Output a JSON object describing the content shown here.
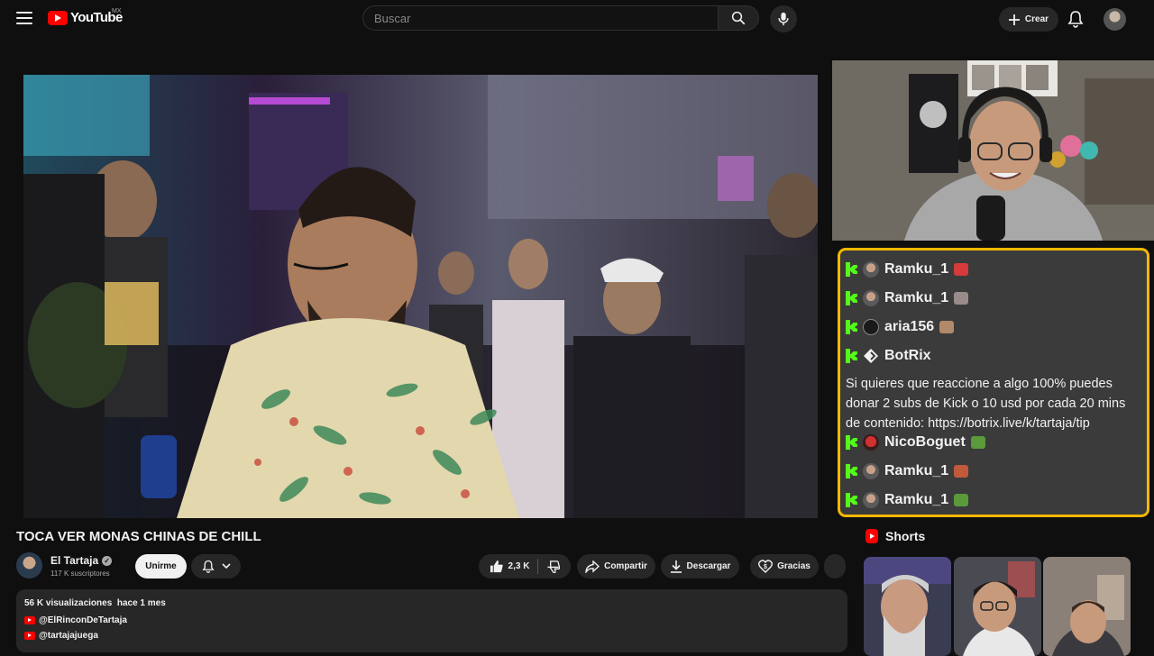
{
  "masthead": {
    "logo_text": "YouTube",
    "country_code": "MX",
    "search_placeholder": "Buscar",
    "create_label": "Crear"
  },
  "video": {
    "title": "TOCA VER MONAS CHINAS DE CHILL"
  },
  "channel": {
    "name": "El Tartaja",
    "subscribers": "117 K suscriptores",
    "join_label": "Unirme"
  },
  "actions": {
    "like_count": "2,3 K",
    "share_label": "Compartir",
    "download_label": "Descargar",
    "thanks_label": "Gracias"
  },
  "description": {
    "views": "56 K visualizaciones",
    "date": "hace 1 mes",
    "links": [
      "@ElRinconDeTartaja",
      "@tartajajuega"
    ]
  },
  "chat": {
    "border_color": "#f5b800",
    "messages": [
      {
        "user": "Ramku_1",
        "emote_color": "#d63a3a"
      },
      {
        "user": "Ramku_1",
        "emote_color": "#9a8b8b"
      },
      {
        "user": "aria156",
        "emote_color": "#b08a6a"
      },
      {
        "user": "BotRix",
        "text": "Si quieres que reaccione a algo 100% puedes donar 2 subs de Kick o 10 usd por cada 20 mins de contenido: https://botrix.live/k/tartaja/tip"
      },
      {
        "user": "NicoBoguet",
        "emote_color": "#5a9a3a"
      },
      {
        "user": "Ramku_1",
        "emote_color": "#c05a3a"
      },
      {
        "user": "Ramku_1",
        "emote_color": "#5a9a3a"
      }
    ]
  },
  "shorts": {
    "heading": "Shorts"
  }
}
